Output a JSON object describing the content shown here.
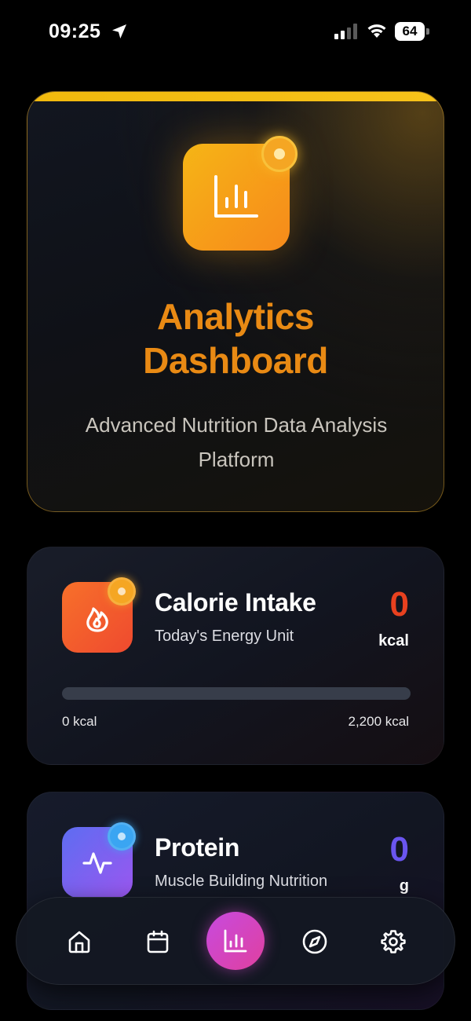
{
  "status_bar": {
    "time": "09:25",
    "battery": "64",
    "icons": [
      "location-arrow-icon",
      "cellular-signal-icon",
      "wifi-icon",
      "battery-icon"
    ]
  },
  "hero": {
    "icon": "bar-chart-icon",
    "title_line1": "Analytics",
    "title_line2": "Dashboard",
    "subtitle": "Advanced Nutrition Data Analysis Platform",
    "accent_color": "#f1b90d"
  },
  "calorie_card": {
    "icon": "flame-icon",
    "title": "Calorie Intake",
    "subtitle": "Today's Energy Unit",
    "value": "0",
    "unit": "kcal",
    "progress_fraction": 0,
    "range_min": "0 kcal",
    "range_max": "2,200 kcal",
    "value_color": "#e8411f"
  },
  "protein_card": {
    "icon": "pulse-icon",
    "title": "Protein",
    "subtitle": "Muscle Building Nutrition",
    "value": "0",
    "unit": "g",
    "value_color": "#6a55ef"
  },
  "tab_bar": {
    "tabs": [
      {
        "icon": "home-icon",
        "active": false
      },
      {
        "icon": "calendar-icon",
        "active": false
      },
      {
        "icon": "bar-chart-icon",
        "active": true
      },
      {
        "icon": "compass-icon",
        "active": false
      },
      {
        "icon": "gear-icon",
        "active": false
      }
    ],
    "active_color": "#d044c8"
  }
}
